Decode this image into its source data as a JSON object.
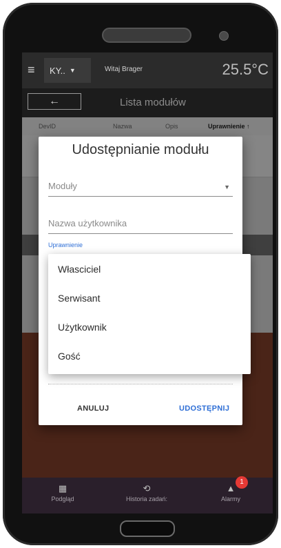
{
  "topbar": {
    "module_select": "KY..",
    "greeting": "Witaj Brager",
    "temperature": "25.5°C"
  },
  "subbar": {
    "back_icon": "arrow-left-icon",
    "title": "Lista modułów"
  },
  "table": {
    "headers": [
      "DevID",
      "Nazwa",
      "Opis",
      "Uprawnienie ↑"
    ]
  },
  "dialog": {
    "title": "Udostępnianie modułu",
    "modules_placeholder": "Moduły",
    "username_placeholder": "Nazwa użytkownika",
    "permission_label": "Uprawnienie",
    "cancel_label": "ANULUJ",
    "share_label": "UDOSTĘPNIJ"
  },
  "dropdown": {
    "options": [
      "Własciciel",
      "Serwisant",
      "Użytkownik",
      "Gość"
    ]
  },
  "bottom_nav": {
    "items": [
      {
        "label": "Podgląd",
        "icon": "grid-icon"
      },
      {
        "label": "Historia zadań:",
        "icon": "history-icon"
      },
      {
        "label": "Alarmy",
        "icon": "warning-icon"
      }
    ],
    "alarm_count": "1"
  },
  "colors": {
    "accent": "#2f6fd6",
    "badge": "#e53935",
    "topbar": "#2b2b2b",
    "background": "#4a2418"
  }
}
